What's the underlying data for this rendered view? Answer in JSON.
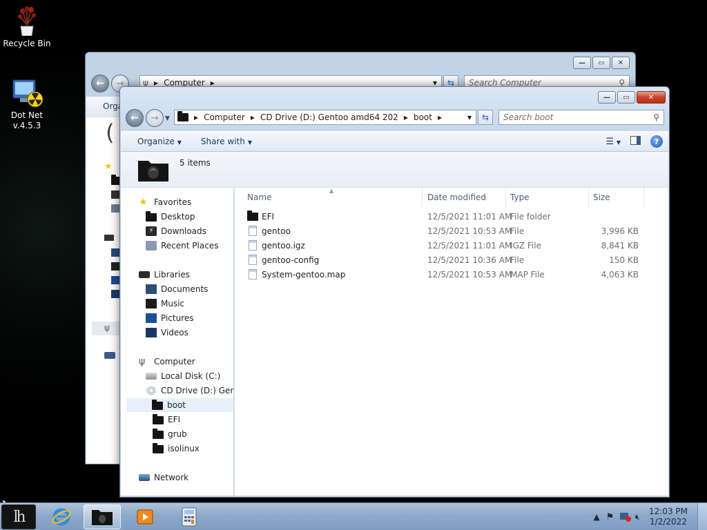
{
  "desktop": {
    "icons": [
      {
        "label": "Recycle Bin",
        "icon": "recycle-bin-icon"
      },
      {
        "label": "Dot Net\nv.4.5.3",
        "icon": "dotnet-installer-icon"
      }
    ]
  },
  "back_window": {
    "address": [
      "Computer"
    ],
    "search_placeholder": "Search Computer",
    "toolbar_partial": "Orga"
  },
  "window": {
    "address": {
      "segments": [
        "Computer",
        "CD Drive (D:) Gentoo amd64 202",
        "boot"
      ]
    },
    "search": {
      "placeholder": "Search boot"
    },
    "toolbar": {
      "organize": "Organize",
      "share_with": "Share with"
    },
    "details": {
      "count": "5 items"
    },
    "nav": {
      "favorites": "Favorites",
      "desktop": "Desktop",
      "downloads": "Downloads",
      "recent_places": "Recent Places",
      "libraries": "Libraries",
      "documents": "Documents",
      "music": "Music",
      "pictures": "Pictures",
      "videos": "Videos",
      "computer": "Computer",
      "local_disk": "Local Disk (C:)",
      "cd_drive": "CD Drive (D:) Gentoo",
      "boot": "boot",
      "efi": "EFI",
      "grub": "grub",
      "isolinux": "isolinux",
      "network": "Network"
    },
    "columns": {
      "name": "Name",
      "date_modified": "Date modified",
      "type": "Type",
      "size": "Size"
    },
    "files": [
      {
        "name": "EFI",
        "date": "12/5/2021 11:01 AM",
        "type": "File folder",
        "size": "",
        "icon": "folder"
      },
      {
        "name": "gentoo",
        "date": "12/5/2021 10:53 AM",
        "type": "File",
        "size": "3,996 KB",
        "icon": "file"
      },
      {
        "name": "gentoo.igz",
        "date": "12/5/2021 11:01 AM",
        "type": "IGZ File",
        "size": "8,841 KB",
        "icon": "file"
      },
      {
        "name": "gentoo-config",
        "date": "12/5/2021 10:36 AM",
        "type": "File",
        "size": "150 KB",
        "icon": "file"
      },
      {
        "name": "System-gentoo.map",
        "date": "12/5/2021 10:53 AM",
        "type": "MAP File",
        "size": "4,063 KB",
        "icon": "file"
      }
    ]
  },
  "taskbar": {
    "start_glyph": "lh",
    "apps": [
      "internet-explorer-icon",
      "explorer-folder-icon",
      "media-player-icon",
      "calculator-icon"
    ],
    "clock": {
      "time": "12:03 PM",
      "date": "1/2/2022"
    }
  },
  "colors": {
    "selection": "#e5f0fb",
    "close_button": "#c9432a",
    "taskbar": "#8ea9c9"
  }
}
